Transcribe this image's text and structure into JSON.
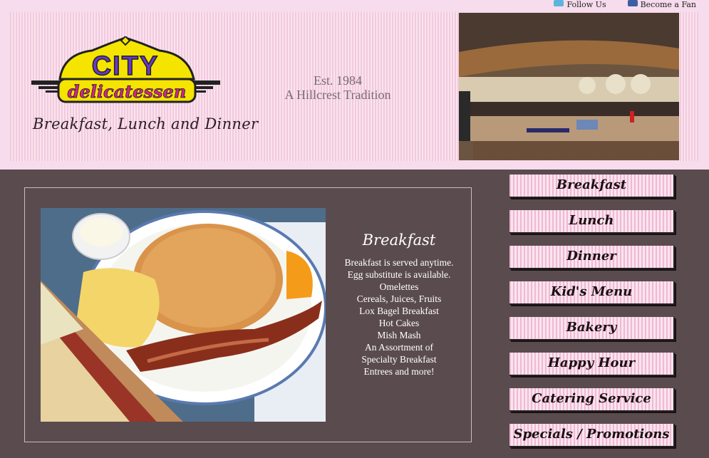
{
  "social": {
    "follow_label": "Follow Us",
    "fan_label": "Become a Fan"
  },
  "header": {
    "logo_top": "CITY",
    "logo_bottom": "delicatessen",
    "tagline": "Breakfast, Lunch and Dinner",
    "est_line1": "Est. 1984",
    "est_line2": "A Hillcrest Tradition"
  },
  "content": {
    "title": "Breakfast",
    "lines": [
      "Breakfast is served anytime.",
      "Egg substitute is available.",
      "Omelettes",
      "Cereals, Juices, Fruits",
      "Lox Bagel Breakfast",
      "Hot Cakes",
      "Mish Mash",
      "An Assortment of",
      "Specialty Breakfast",
      "Entrees and more!"
    ]
  },
  "nav": [
    "Breakfast",
    "Lunch",
    "Dinner",
    "Kid's Menu",
    "Bakery",
    "Happy Hour",
    "Catering Service",
    "Specials / Promotions"
  ],
  "colors": {
    "background": "#f6dcec",
    "panel": "#5a4b4f",
    "logo_yellow": "#f5e400",
    "logo_purple": "#6a39c8",
    "logo_magenta": "#d6248c"
  }
}
